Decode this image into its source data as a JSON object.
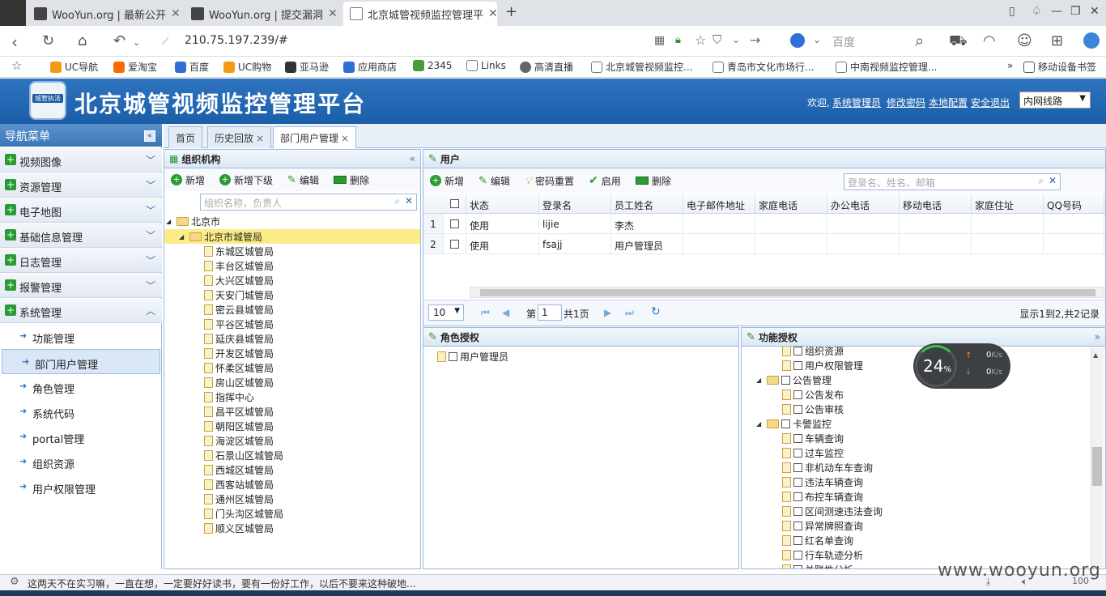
{
  "browser": {
    "tabs": [
      {
        "label": "WooYun.org | 最新公开"
      },
      {
        "label": "WooYun.org | 提交漏洞"
      },
      {
        "label": "北京城管视频监控管理平"
      }
    ],
    "new_tab": "+",
    "url": "210.75.197.239/#",
    "search_engine": "百度",
    "bookmarks": [
      "UC导航",
      "爱淘宝",
      "百度",
      "UC购物",
      "亚马逊",
      "应用商店",
      "2345",
      "Links",
      "高清直播",
      "北京城管视频监控...",
      "青岛市文化市场行...",
      "中南视频监控管理..."
    ],
    "bookmark_more": "»",
    "mobile_bookmarks": "移动设备书签"
  },
  "header": {
    "title": "北京城管视频监控管理平台",
    "badge": "城管执法",
    "welcome": "欢迎,",
    "user": "系统管理员",
    "change_pwd": "修改密码",
    "local_cfg": "本地配置",
    "logout": "安全退出",
    "line": "内网线路"
  },
  "nav": {
    "title": "导航菜单",
    "sections": [
      "视频图像",
      "资源管理",
      "电子地图",
      "基础信息管理",
      "日志管理",
      "报警管理",
      "系统管理"
    ],
    "items": [
      "功能管理",
      "部门用户管理",
      "角色管理",
      "系统代码",
      "portal管理",
      "组织资源",
      "用户权限管理"
    ]
  },
  "tabs": [
    "首页",
    "历史回放",
    "部门用户管理"
  ],
  "org": {
    "title": "组织机构",
    "tools": [
      "新增",
      "新增下级",
      "编辑",
      "删除"
    ],
    "search_placeholder": "组织名称，负责人",
    "root": "北京市",
    "selected": "北京市城管局",
    "children": [
      "东城区城管局",
      "丰台区城管局",
      "大兴区城管局",
      "天安门城管局",
      "密云县城管局",
      "平谷区城管局",
      "延庆县城管局",
      "开发区城管局",
      "怀柔区城管局",
      "房山区城管局",
      "指挥中心",
      "昌平区城管局",
      "朝阳区城管局",
      "海淀区城管局",
      "石景山区城管局",
      "西城区城管局",
      "西客站城管局",
      "通州区城管局",
      "门头沟区城管局",
      "顺义区城管局"
    ]
  },
  "user": {
    "title": "用户",
    "tools": [
      "新增",
      "编辑",
      "密码重置",
      "启用",
      "删除"
    ],
    "search_placeholder": "登录名、姓名、邮箱",
    "columns": [
      "状态",
      "登录名",
      "员工姓名",
      "电子邮件地址",
      "家庭电话",
      "办公电话",
      "移动电话",
      "家庭住址",
      "QQ号码"
    ],
    "rows": [
      {
        "no": "1",
        "status": "使用",
        "login": "lijie",
        "name": "李杰"
      },
      {
        "no": "2",
        "status": "使用",
        "login": "fsajj",
        "name": "用户管理员"
      }
    ],
    "page_size": "10",
    "page_label": "第",
    "page": "1",
    "total_pages": "共1页",
    "summary": "显示1到2,共2记录"
  },
  "role": {
    "title": "角色授权",
    "items": [
      "用户管理员"
    ]
  },
  "func": {
    "title": "功能授权",
    "items": [
      {
        "t": "组织资源",
        "type": "leaf",
        "lvl": 2
      },
      {
        "t": "用户权限管理",
        "type": "leaf",
        "lvl": 2
      },
      {
        "t": "公告管理",
        "type": "folder",
        "lvl": 1
      },
      {
        "t": "公告发布",
        "type": "leaf",
        "lvl": 2
      },
      {
        "t": "公告审核",
        "type": "leaf",
        "lvl": 2
      },
      {
        "t": "卡警监控",
        "type": "folder",
        "lvl": 1
      },
      {
        "t": "车辆查询",
        "type": "leaf",
        "lvl": 2
      },
      {
        "t": "过车监控",
        "type": "leaf",
        "lvl": 2
      },
      {
        "t": "非机动车车查询",
        "type": "leaf",
        "lvl": 2
      },
      {
        "t": "违法车辆查询",
        "type": "leaf",
        "lvl": 2
      },
      {
        "t": "布控车辆查询",
        "type": "leaf",
        "lvl": 2
      },
      {
        "t": "区间测速违法查询",
        "type": "leaf",
        "lvl": 2
      },
      {
        "t": "异常牌照查询",
        "type": "leaf",
        "lvl": 2
      },
      {
        "t": "红名单查询",
        "type": "leaf",
        "lvl": 2
      },
      {
        "t": "行车轨迹分析",
        "type": "leaf",
        "lvl": 2
      },
      {
        "t": "关联性分析",
        "type": "leaf",
        "lvl": 2
      }
    ]
  },
  "speed": {
    "pct": "24",
    "pct_unit": "%",
    "up": "0",
    "down": "0",
    "unit": "K/s"
  },
  "status": "这两天不在实习嘛，一直在想，一定要好好读书，要有一份好工作，以后不要来这种破地...",
  "watermark": "www.wooyun.org",
  "zoom": "100"
}
